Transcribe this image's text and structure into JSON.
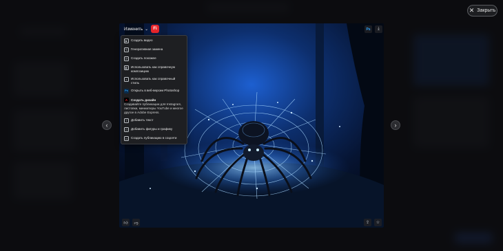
{
  "modal": {
    "close_label": "Закрыть",
    "edit_label": "Изменить",
    "firefly_badge": "Fi",
    "top_right_icons": [
      "photoshop-icon",
      "download-icon"
    ],
    "bottom_left_icons": [
      "thumbs-up-icon",
      "thumbs-down-icon"
    ],
    "bottom_right_icons": [
      "share-icon",
      "favorite-icon"
    ]
  },
  "menu": {
    "items_top": [
      {
        "label": "Создать видео",
        "icon": "video-icon"
      },
      {
        "label": "Генеративная замена",
        "icon": "generative-fill-icon"
      },
      {
        "label": "Создать похожее",
        "icon": "similar-icon"
      },
      {
        "label": "Использовать как справочную композицию",
        "icon": "composition-reference-icon"
      },
      {
        "label": "Использовать как справочный стиль",
        "icon": "style-reference-icon"
      },
      {
        "label": "Открыть в веб-версии Photoshop",
        "icon": "photoshop-icon"
      }
    ],
    "section": {
      "title": "Создать дизайн",
      "description": "Создавайте публикации для Instagram, листовки, миниатюры YouTube и многое другое в Adobe Express."
    },
    "items_bottom": [
      {
        "label": "Добавить текст",
        "icon": "text-icon"
      },
      {
        "label": "Добавить фигуры и графику",
        "icon": "shapes-icon"
      },
      {
        "label": "Создать публикацию в соцсети",
        "icon": "social-post-icon"
      }
    ]
  },
  "colors": {
    "accent_red": "#e8262b",
    "image_blue": "#2f7dff",
    "menu_bg": "#1e1f22"
  }
}
